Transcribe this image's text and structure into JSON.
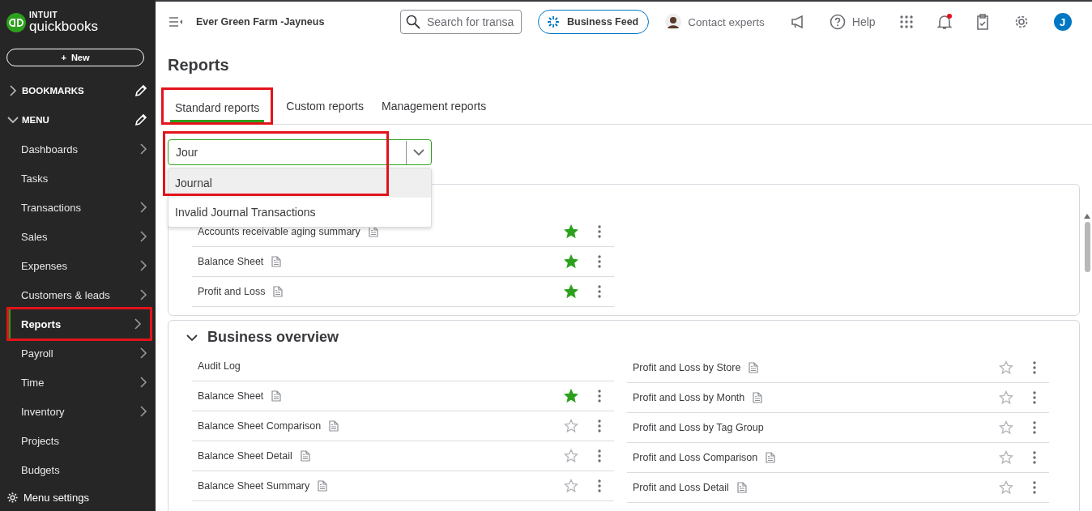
{
  "brand": {
    "top": "INTUIT",
    "name": "quickbooks"
  },
  "new_button": {
    "icon": "+",
    "label": "New"
  },
  "sidebar": {
    "sections": [
      {
        "label": "BOOKMARKS",
        "expanded": false
      },
      {
        "label": "MENU",
        "expanded": true
      }
    ],
    "items": [
      {
        "label": "Dashboards",
        "has_submenu": true,
        "selected": false,
        "highlighted": false
      },
      {
        "label": "Tasks",
        "has_submenu": false,
        "selected": false,
        "highlighted": false
      },
      {
        "label": "Transactions",
        "has_submenu": true,
        "selected": false,
        "highlighted": false
      },
      {
        "label": "Sales",
        "has_submenu": true,
        "selected": false,
        "highlighted": false
      },
      {
        "label": "Expenses",
        "has_submenu": true,
        "selected": false,
        "highlighted": false
      },
      {
        "label": "Customers & leads",
        "has_submenu": true,
        "selected": false,
        "highlighted": false
      },
      {
        "label": "Reports",
        "has_submenu": true,
        "selected": true,
        "highlighted": true
      },
      {
        "label": "Payroll",
        "has_submenu": true,
        "selected": false,
        "highlighted": false
      },
      {
        "label": "Time",
        "has_submenu": true,
        "selected": false,
        "highlighted": false
      },
      {
        "label": "Inventory",
        "has_submenu": true,
        "selected": false,
        "highlighted": false
      },
      {
        "label": "Projects",
        "has_submenu": false,
        "selected": false,
        "highlighted": false
      },
      {
        "label": "Budgets",
        "has_submenu": false,
        "selected": false,
        "highlighted": false
      }
    ],
    "settings": "Menu settings"
  },
  "topbar": {
    "company": "Ever Green Farm -Jayneus",
    "search_placeholder": "Search for transa",
    "feed_button": "Business Feed",
    "contact": "Contact experts",
    "help": "Help",
    "notification_dot": true,
    "avatar_initial": "J"
  },
  "page_title": "Reports",
  "tabs": [
    {
      "label": "Standard reports",
      "selected": true,
      "highlighted": true
    },
    {
      "label": "Custom reports",
      "selected": false,
      "highlighted": false
    },
    {
      "label": "Management reports",
      "selected": false,
      "highlighted": false
    }
  ],
  "report_search": {
    "value": "Jour",
    "highlighted": true,
    "suggestions": [
      {
        "label": "Journal",
        "selected": true
      },
      {
        "label": "Invalid Journal Transactions",
        "selected": false
      }
    ]
  },
  "favorites": {
    "rows": [
      {
        "name": "Accounts receivable aging summary",
        "has_report_icon": true,
        "starred": true
      },
      {
        "name": "Balance Sheet",
        "has_report_icon": true,
        "starred": true
      },
      {
        "name": "Profit and Loss",
        "has_report_icon": true,
        "starred": true
      }
    ]
  },
  "business_overview": {
    "title": "Business overview",
    "expanded": true,
    "left": [
      {
        "name": "Audit Log",
        "has_report_icon": false,
        "has_actions": false
      },
      {
        "name": "Balance Sheet",
        "has_report_icon": true,
        "starred": true,
        "has_actions": true
      },
      {
        "name": "Balance Sheet Comparison",
        "has_report_icon": true,
        "starred": false,
        "has_actions": true
      },
      {
        "name": "Balance Sheet Detail",
        "has_report_icon": true,
        "starred": false,
        "has_actions": true
      },
      {
        "name": "Balance Sheet Summary",
        "has_report_icon": true,
        "starred": false,
        "has_actions": true
      }
    ],
    "right": [
      {
        "name": "Profit and Loss by Store",
        "has_report_icon": true,
        "starred": false,
        "has_actions": true
      },
      {
        "name": "Profit and Loss by Month",
        "has_report_icon": true,
        "starred": false,
        "has_actions": true
      },
      {
        "name": "Profit and Loss by Tag Group",
        "has_report_icon": false,
        "starred": false,
        "has_actions": true
      },
      {
        "name": "Profit and Loss Comparison",
        "has_report_icon": true,
        "starred": false,
        "has_actions": true
      },
      {
        "name": "Profit and Loss Detail",
        "has_report_icon": true,
        "starred": false,
        "has_actions": true
      }
    ]
  }
}
